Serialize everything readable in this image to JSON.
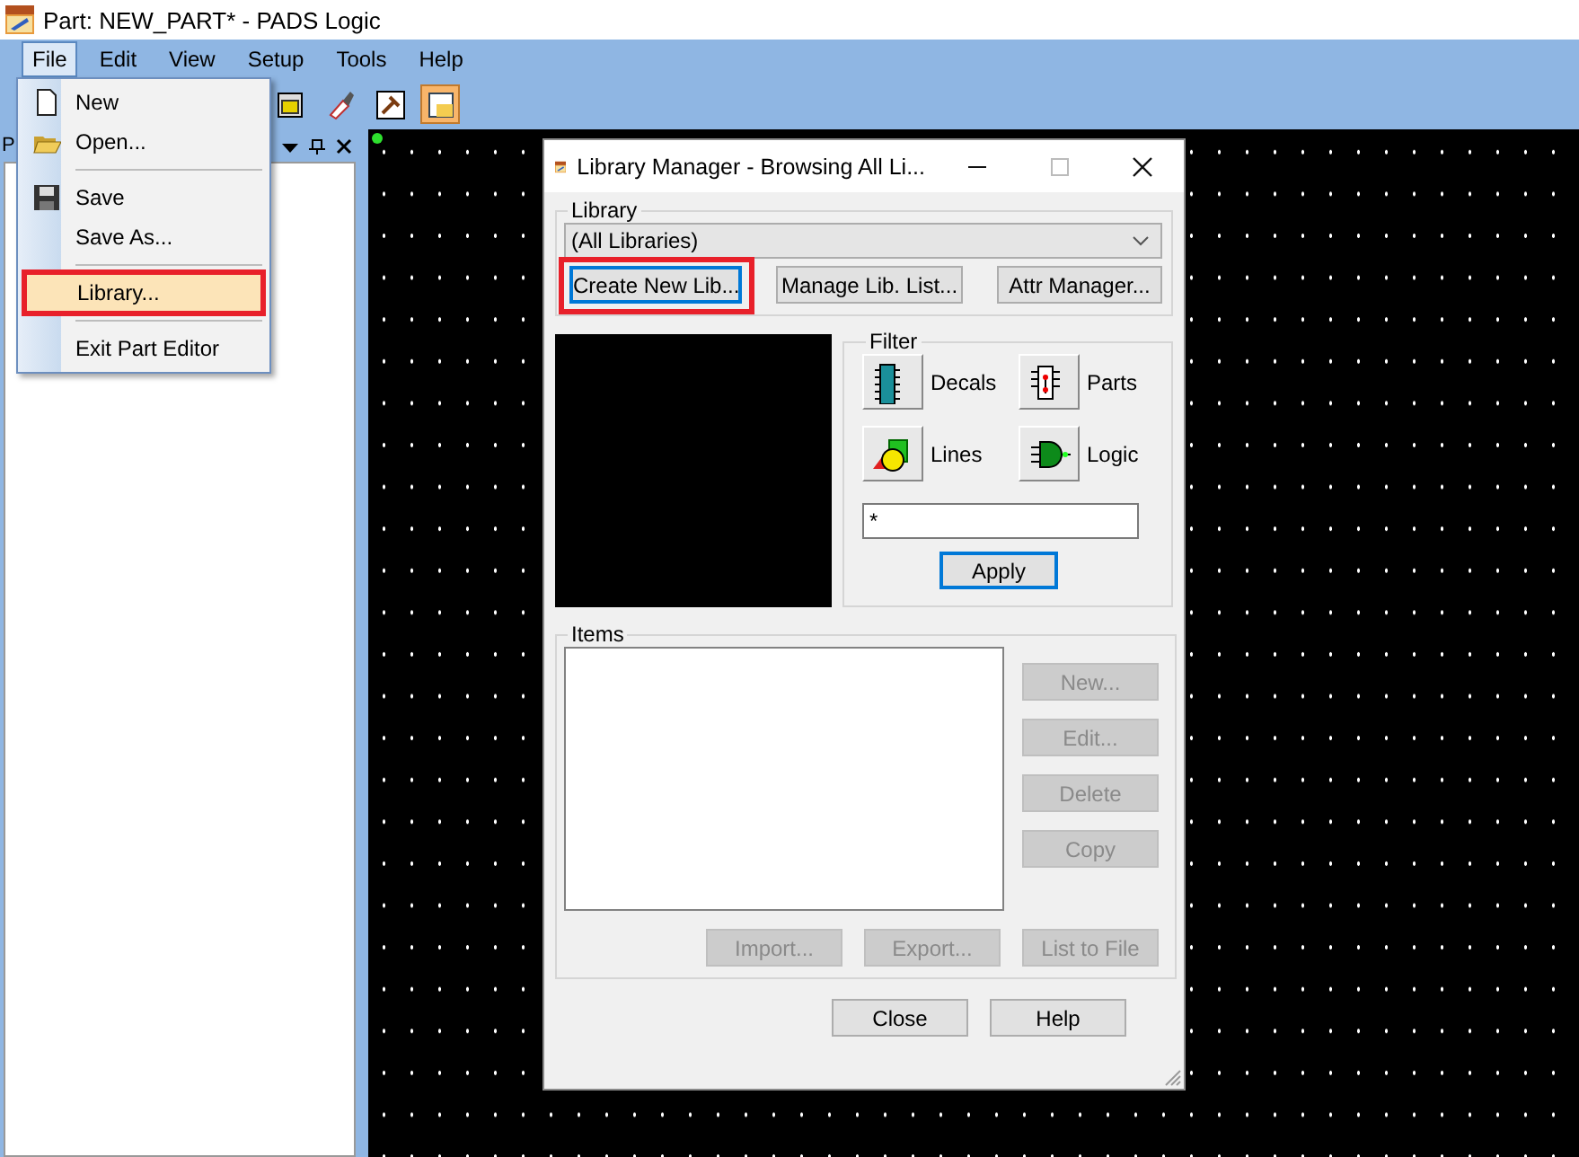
{
  "window": {
    "title": "Part: NEW_PART* - PADS Logic"
  },
  "menu_bar": [
    {
      "label": "File",
      "selected": true
    },
    {
      "label": "Edit",
      "selected": false
    },
    {
      "label": "View",
      "selected": false
    },
    {
      "label": "Setup",
      "selected": false
    },
    {
      "label": "Tools",
      "selected": false
    },
    {
      "label": "Help",
      "selected": false
    }
  ],
  "file_menu": [
    {
      "kind": "item",
      "label": "New",
      "selected": false,
      "annotated": false
    },
    {
      "kind": "item",
      "label": "Open...",
      "selected": false,
      "annotated": false
    },
    {
      "kind": "separator"
    },
    {
      "kind": "item",
      "label": "Save",
      "selected": false,
      "annotated": false
    },
    {
      "kind": "item",
      "label": "Save As...",
      "selected": false,
      "annotated": false
    },
    {
      "kind": "separator"
    },
    {
      "kind": "item",
      "label": "Library...",
      "selected": true,
      "annotated": true
    },
    {
      "kind": "separator"
    },
    {
      "kind": "item",
      "label": "Exit Part Editor",
      "selected": false,
      "annotated": false
    }
  ],
  "side_panel": {
    "title": "P"
  },
  "dialog": {
    "title": "Library Manager - Browsing All Li...",
    "library": {
      "label": "Library",
      "value": "(All Libraries)",
      "buttons": [
        {
          "label": "Create New Lib...",
          "focused": true,
          "annotated": true
        },
        {
          "label": "Manage Lib. List...",
          "focused": false,
          "annotated": false
        },
        {
          "label": "Attr Manager...",
          "focused": false,
          "annotated": false
        }
      ]
    },
    "filter": {
      "label": "Filter",
      "types": [
        {
          "label": "Decals"
        },
        {
          "label": "Parts"
        },
        {
          "label": "Lines"
        },
        {
          "label": "Logic"
        }
      ],
      "pattern": "*",
      "apply": {
        "label": "Apply",
        "focused": true
      }
    },
    "items": {
      "label": "Items",
      "side_buttons": [
        {
          "label": "New...",
          "disabled": true
        },
        {
          "label": "Edit...",
          "disabled": true
        },
        {
          "label": "Delete",
          "disabled": true
        },
        {
          "label": "Copy",
          "disabled": true
        }
      ],
      "bottom_buttons": [
        {
          "label": "Import...",
          "disabled": true
        },
        {
          "label": "Export...",
          "disabled": true
        },
        {
          "label": "List to File",
          "disabled": true
        }
      ]
    },
    "footer_buttons": [
      {
        "label": "Close",
        "disabled": false
      },
      {
        "label": "Help",
        "disabled": false
      }
    ]
  }
}
